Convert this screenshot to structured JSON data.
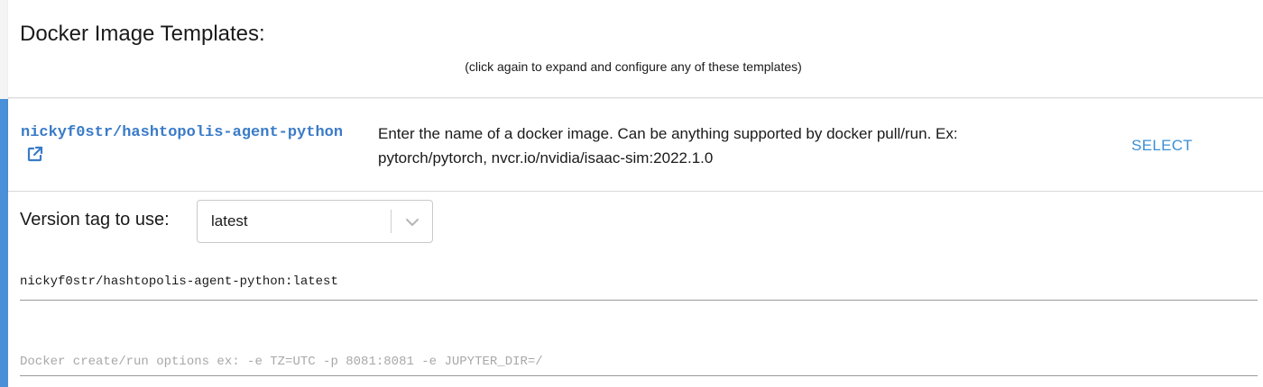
{
  "header": {
    "title": "Docker Image Templates:",
    "subtitle": "(click again to expand and configure any of these templates)"
  },
  "template": {
    "name": "nickyf0str/hashtopolis-agent-python",
    "description": "Enter the name of a docker image. Can be anything supported by docker pull/run. Ex: pytorch/pytorch, nvcr.io/nvidia/isaac-sim:2022.1.0",
    "select_label": "SELECT",
    "link_icon": "external-link-icon"
  },
  "config": {
    "version_label": "Version tag to use:",
    "version_value": "latest",
    "dropdown_icon": "chevron-down-icon",
    "image_ref": "nickyf0str/hashtopolis-agent-python:latest",
    "options_placeholder": "Docker create/run options ex: -e TZ=UTC -p 8081:8081 -e JUPYTER_DIR=/"
  },
  "colors": {
    "link": "#3a7bc8",
    "accent": "#3a8fd6",
    "left_accent": "#4a90d9"
  }
}
